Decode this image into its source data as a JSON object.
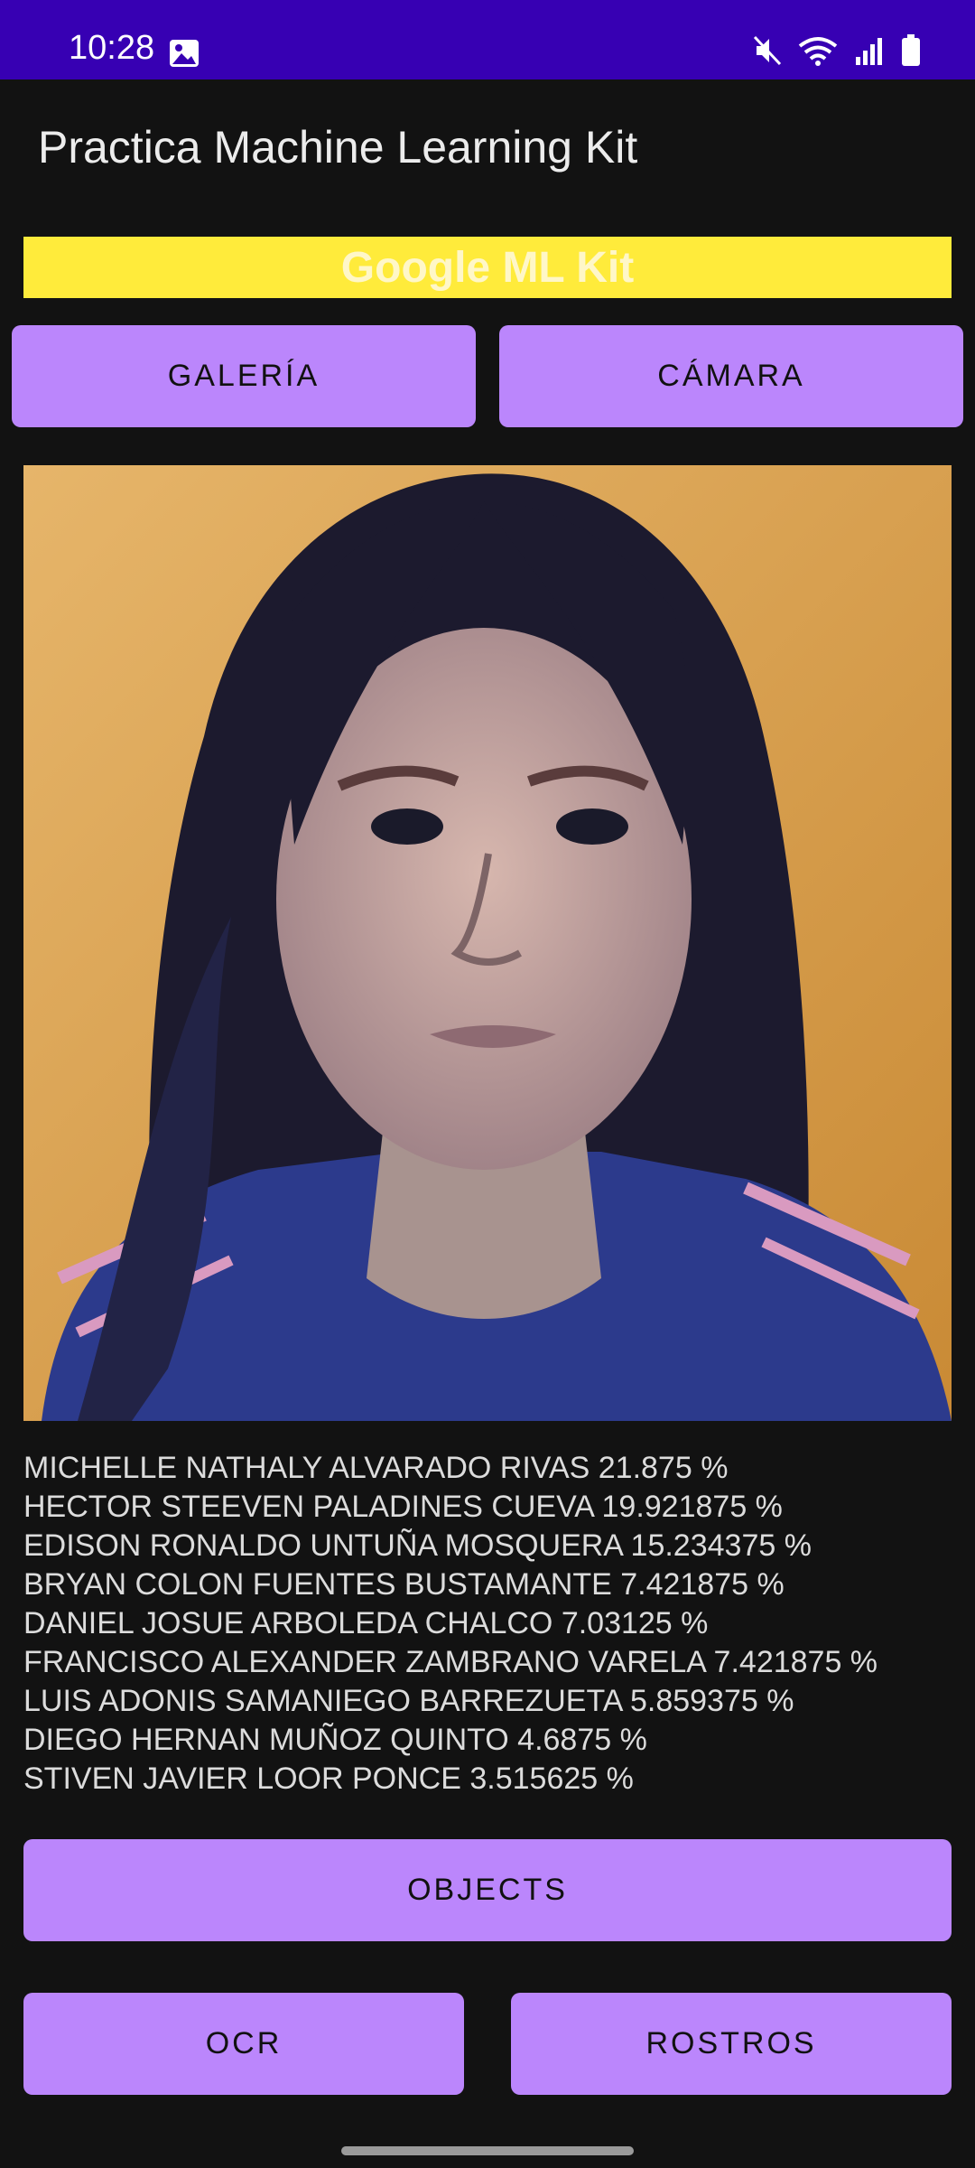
{
  "status_bar": {
    "time": "10:28"
  },
  "app_bar": {
    "title": "Practica Machine Learning Kit"
  },
  "banner": {
    "text": "Google ML Kit"
  },
  "buttons": {
    "galeria": "GALERÍA",
    "camara": "CÁMARA",
    "objects": "OBJECTS",
    "ocr": "OCR",
    "rostros": "ROSTROS"
  },
  "results": [
    "MICHELLE NATHALY ALVARADO RIVAS 21.875 %",
    "HECTOR STEEVEN PALADINES CUEVA 19.921875 %",
    "EDISON RONALDO UNTUÑA MOSQUERA 15.234375 %",
    "BRYAN COLON FUENTES BUSTAMANTE 7.421875 %",
    "DANIEL JOSUE ARBOLEDA CHALCO 7.03125 %",
    "FRANCISCO ALEXANDER ZAMBRANO VARELA 7.421875 %",
    "LUIS ADONIS SAMANIEGO BARREZUETA 5.859375 %",
    "DIEGO HERNAN MUÑOZ QUINTO 4.6875 %",
    "STIVEN JAVIER LOOR PONCE 3.515625 %"
  ],
  "colors": {
    "status_bar": "#3700b3",
    "button": "#bb86fc",
    "banner": "#ffeb3b",
    "background": "#121212"
  }
}
